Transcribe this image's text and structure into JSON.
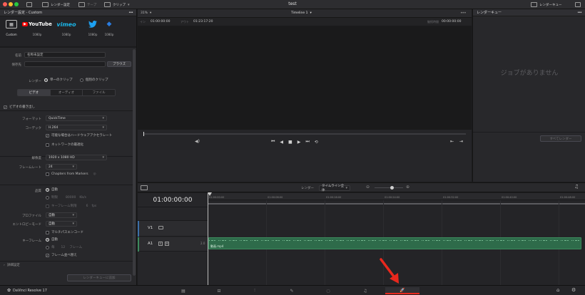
{
  "window": {
    "title": "test",
    "toolbar_left": [
      {
        "label": "レンダー設定",
        "icon": "render-settings-icon"
      },
      {
        "label": "テープ",
        "icon": "tape-icon"
      },
      {
        "label": "クリップ",
        "icon": "clip-icon"
      }
    ],
    "toolbar_right": {
      "label": "レンダーキュー",
      "icon": "render-queue-icon"
    }
  },
  "left_panel": {
    "title": "レンダー設定 - Custom",
    "presets": [
      {
        "logo": "▦",
        "caption": "Custom",
        "selected": true
      },
      {
        "logo": "▶YouTube",
        "caption": "1080p",
        "color": "#ff0000"
      },
      {
        "logo": "vimeo",
        "caption": "1080p",
        "color": "#1ab7ea"
      },
      {
        "logo": "🐦",
        "caption": "1080p",
        "color": "#1da1f2"
      },
      {
        "logo": "◆",
        "caption": "1080p",
        "color": "#2a7de1"
      }
    ],
    "name_label": "名前",
    "name_value": "名称未設定",
    "location_label": "保存先",
    "location_value": "",
    "browse_button": "ブラウズ",
    "render_label": "レンダー",
    "render_single": "単一のクリップ",
    "render_individual": "個別のクリップ",
    "tabs": [
      "ビデオ",
      "オーディオ",
      "ファイル"
    ],
    "export_video": "ビデオの書き出し",
    "format_label": "フォーマット",
    "format_value": "QuickTime",
    "codec_label": "コーデック",
    "codec_value": "H.264",
    "hw_accel": "可能な場合はハードウェアアクセラレート",
    "network_opt": "ネットワークの最適化",
    "resolution_label": "解像度",
    "resolution_value": "1920 x 1080 HD",
    "framerate_label": "フレームレート",
    "framerate_value": "24",
    "chapters": "Chapters from Markers",
    "quality_label": "品質",
    "quality_auto": "自動",
    "quality_limit": "制限",
    "quality_limit_value": "80000",
    "quality_limit_unit": "Kb/s",
    "quality_restrict": "キーフレーム制限",
    "quality_restrict_value": "6",
    "quality_restrict_unit": "fps",
    "profile_label": "プロファイル",
    "profile_value": "自動",
    "entropy_label": "エントロピーモード",
    "entropy_value": "自動",
    "multipass": "マルチパスエンコード",
    "keyframe_label": "キーフレーム",
    "keyframe_auto": "自動",
    "keyframe_every": "毎",
    "keyframe_every_value": "12",
    "keyframe_unit": "フレーム",
    "frame_reorder": "フレーム並べ替え",
    "advanced": "詳細設定",
    "add_to_queue": "レンダーキューに追加"
  },
  "viewer": {
    "zoom": "31%",
    "timeline_name": "Timeline 1",
    "in_label": "イン",
    "in_tc": "01:00:00:00",
    "out_label": "アウト",
    "out_tc": "01:23:17:20",
    "duration_label": "継続時間",
    "duration_tc": "00:00:00:00"
  },
  "render_queue": {
    "title": "レンダーキュー",
    "empty_message": "ジョブがありません",
    "render_all": "すべてレンダー"
  },
  "timeline": {
    "render_label": "レンダー",
    "render_mode": "タイムライン全体",
    "timecode": "01:00:00:00",
    "ruler": [
      "01:00:00:00",
      "01:00:08:00",
      "01:00:16:00",
      "01:00:24:00",
      "01:00:32:00",
      "01:00:40:00",
      "01:00:48:00"
    ],
    "v1_label": "V1",
    "a1_label": "A1",
    "a1_channels": "2.0",
    "audio_clip": "動画.mp4"
  },
  "app": {
    "name": "DaVinci Resolve 17"
  },
  "pages": [
    {
      "name": "media",
      "icon": "media-page-icon"
    },
    {
      "name": "cut",
      "icon": "cut-page-icon"
    },
    {
      "name": "edit",
      "icon": "edit-page-icon"
    },
    {
      "name": "fusion",
      "icon": "fusion-page-icon"
    },
    {
      "name": "color",
      "icon": "color-page-icon"
    },
    {
      "name": "fairlight",
      "icon": "fairlight-page-icon"
    },
    {
      "name": "deliver",
      "icon": "deliver-page-icon",
      "active": true
    }
  ],
  "colors": {
    "accent_red": "#e8281d",
    "audio_clip": "#2e6b4a",
    "audio_clip_light": "#3c8a5d"
  }
}
